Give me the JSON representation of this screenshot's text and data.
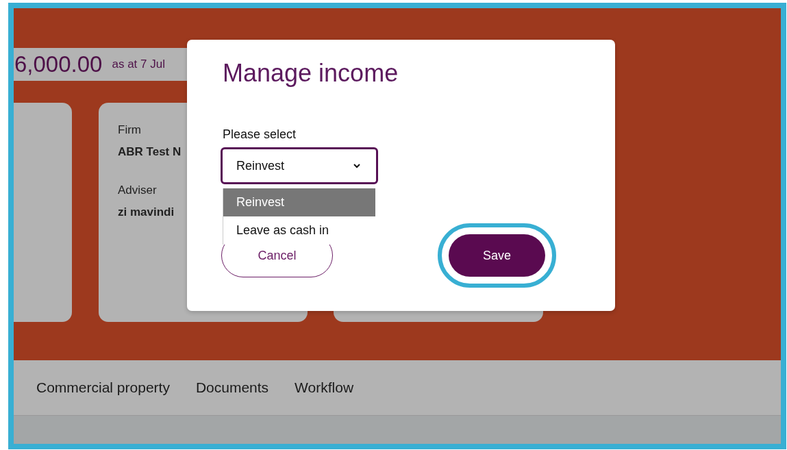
{
  "background": {
    "balance": "6,000.00",
    "balance_date": "as at 7 Jul",
    "cards": [
      {
        "kind": "blank"
      },
      {
        "kind": "details",
        "fields": [
          {
            "label": "Firm",
            "value": "ABR Test N"
          },
          {
            "label": "Adviser",
            "value": "zi mavindi"
          }
        ]
      },
      {
        "kind": "blank"
      }
    ],
    "tabs": [
      {
        "label": "Commercial property",
        "selected": false
      },
      {
        "label": "Documents",
        "selected": false
      },
      {
        "label": "Workflow",
        "selected": false
      }
    ]
  },
  "dialog": {
    "title": "Manage income",
    "select_label": "Please select",
    "select_value": "Reinvest",
    "expanded": true,
    "options": [
      {
        "label": "Reinvest",
        "selected": true
      },
      {
        "label": "Leave as cash in",
        "selected": false
      }
    ],
    "buttons": [
      {
        "label": "Cancel",
        "kind": "secondary",
        "focused": false
      },
      {
        "label": "Save",
        "kind": "primary",
        "focused": true
      }
    ]
  }
}
